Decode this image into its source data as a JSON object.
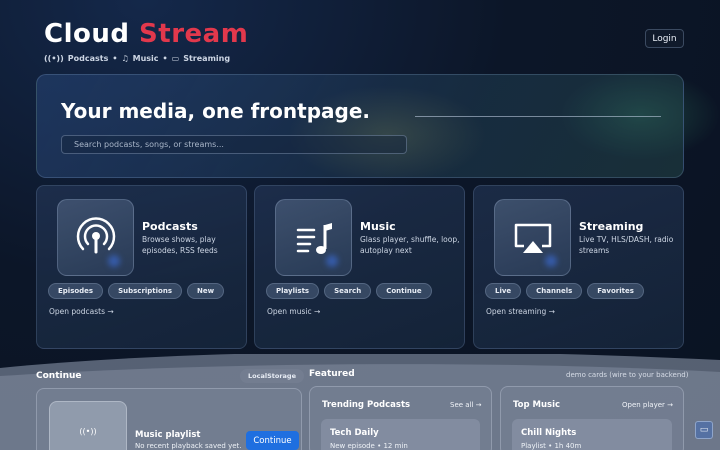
{
  "brand": {
    "part1": "Cloud",
    "part2": "Stream"
  },
  "subnav": [
    {
      "icon": "podcast-icon",
      "label": "Podcasts"
    },
    {
      "icon": "music-icon",
      "label": "Music"
    },
    {
      "icon": "tv-icon",
      "label": "Streaming"
    }
  ],
  "login_label": "Login",
  "hero": {
    "title": "Your media, one frontpage.",
    "search_placeholder": "Search podcasts, songs, or streams..."
  },
  "cards": [
    {
      "title": "Podcasts",
      "desc": "Browse shows, play episodes, RSS feeds",
      "chips": [
        "Episodes",
        "Subscriptions",
        "New"
      ],
      "open": "Open podcasts →",
      "icon": "podcast-icon"
    },
    {
      "title": "Music",
      "desc": "Glass player, shuffle, loop, autoplay next",
      "chips": [
        "Playlists",
        "Search",
        "Continue"
      ],
      "open": "Open music →",
      "icon": "music-icon"
    },
    {
      "title": "Streaming",
      "desc": "Live TV, HLS/DASH, radio streams",
      "chips": [
        "Live",
        "Channels",
        "Favorites"
      ],
      "open": "Open streaming →",
      "icon": "airplay-icon"
    }
  ],
  "continue": {
    "title": "Continue",
    "badge": "LocalStorage",
    "item_title": "Music playlist",
    "item_meta": "No recent playback saved yet.",
    "button": "Continue"
  },
  "featured": {
    "title": "Featured",
    "note": "demo cards (wire to your backend)",
    "panels": [
      {
        "title": "Trending Podcasts",
        "link": "See all →",
        "item_title": "Tech Daily",
        "item_meta": "New episode • 12 min"
      },
      {
        "title": "Top Music",
        "link": "Open player →",
        "item_title": "Chill Nights",
        "item_meta": "Playlist • 1h 40m"
      }
    ]
  },
  "colors": {
    "accent_red": "#e2384c",
    "button_blue": "#1f6fe0"
  }
}
